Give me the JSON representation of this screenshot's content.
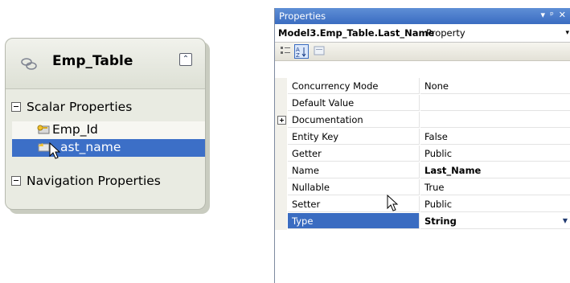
{
  "designer": {
    "entity_name": "Emp_Table",
    "sections": {
      "scalar_label": "Scalar Properties",
      "navigation_label": "Navigation Properties"
    },
    "properties": [
      {
        "label": "Emp_Id",
        "icon": "key-property-icon",
        "selected": false
      },
      {
        "label": "ast_name",
        "icon": "scalar-property-icon",
        "selected": true
      }
    ]
  },
  "properties_window": {
    "title": "Properties",
    "title_controls": [
      "▾",
      "ᵖ",
      "✕"
    ],
    "object_name": "Model3.Emp_Table.Last_Name",
    "object_type": "Property",
    "rows": [
      {
        "name": "Concurrency Mode",
        "value": "None"
      },
      {
        "name": "Default Value",
        "value": ""
      },
      {
        "name": "Documentation",
        "value": "",
        "expandable": true
      },
      {
        "name": "Entity Key",
        "value": "False"
      },
      {
        "name": "Getter",
        "value": "Public"
      },
      {
        "name": "Name",
        "value": "Last_Name",
        "bold": true
      },
      {
        "name": "Nullable",
        "value": "True"
      },
      {
        "name": "Setter",
        "value": "Public"
      },
      {
        "name": "Type",
        "value": "String",
        "bold": true,
        "selected": true
      }
    ]
  },
  "colors": {
    "selection": "#3a6cc1",
    "entity_body": "#e9ebe2"
  }
}
